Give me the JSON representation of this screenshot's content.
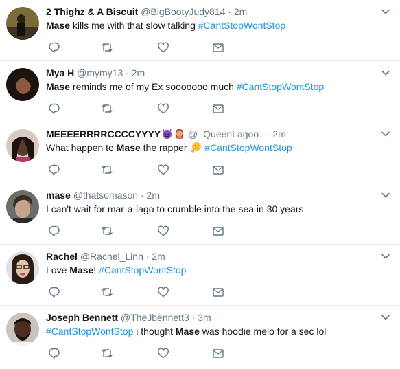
{
  "colors": {
    "link": "#1b95e0",
    "name": "#14171a",
    "meta": "#657786",
    "icon": "#657786",
    "divider": "#e6ecf0"
  },
  "icons": {
    "reply": "reply-icon",
    "retweet": "retweet-icon",
    "like": "heart-icon",
    "dm": "envelope-icon",
    "more": "chevron-down-icon"
  },
  "tweets": [
    {
      "name": "2 Thighz & A Biscuit",
      "handle": "@BigBootyJudy814",
      "sep": "·",
      "time": "2m",
      "segments": [
        {
          "b": "Mase"
        },
        {
          "t": " kills me with that slow talking "
        },
        {
          "h": "#CantStopWontStop"
        }
      ]
    },
    {
      "name": "Mya H",
      "handle": "@mymy13",
      "sep": "·",
      "time": "2m",
      "segments": [
        {
          "b": "Mase"
        },
        {
          "t": " reminds me of my Ex sooooooo much "
        },
        {
          "h": "#CantStopWontStop"
        }
      ]
    },
    {
      "name": "MEEEERRRRCCCCYYYY",
      "name_emojis": [
        "smiling-imp-emoji",
        "woman-emoji"
      ],
      "handle": "@_QueenLagoo_",
      "sep": "·",
      "time": "2m",
      "segments": [
        {
          "t": "What happen to "
        },
        {
          "b": "Mase"
        },
        {
          "t": " the rapper "
        },
        {
          "e": "thinking-face-emoji"
        },
        {
          "t": " "
        },
        {
          "h": "#CantStopWontStop"
        }
      ]
    },
    {
      "name": "mase",
      "handle": "@thatsomason",
      "sep": "·",
      "time": "2m",
      "segments": [
        {
          "t": "I can't wait for mar-a-lago to crumble into the sea in 30 years"
        }
      ]
    },
    {
      "name": "Rachel",
      "handle": "@Rachel_Linn",
      "sep": "·",
      "time": "2m",
      "segments": [
        {
          "t": "Love "
        },
        {
          "b": "Mase"
        },
        {
          "t": "! "
        },
        {
          "h": "#CantStopWontStop"
        }
      ]
    },
    {
      "name": "Joseph Bennett",
      "handle": "@TheJbennett3",
      "sep": "·",
      "time": "3m",
      "segments": [
        {
          "h": "#CantStopWontStop"
        },
        {
          "t": " i thought "
        },
        {
          "b": "Mase"
        },
        {
          "t": " was hoodie melo for a sec lol"
        }
      ]
    }
  ]
}
